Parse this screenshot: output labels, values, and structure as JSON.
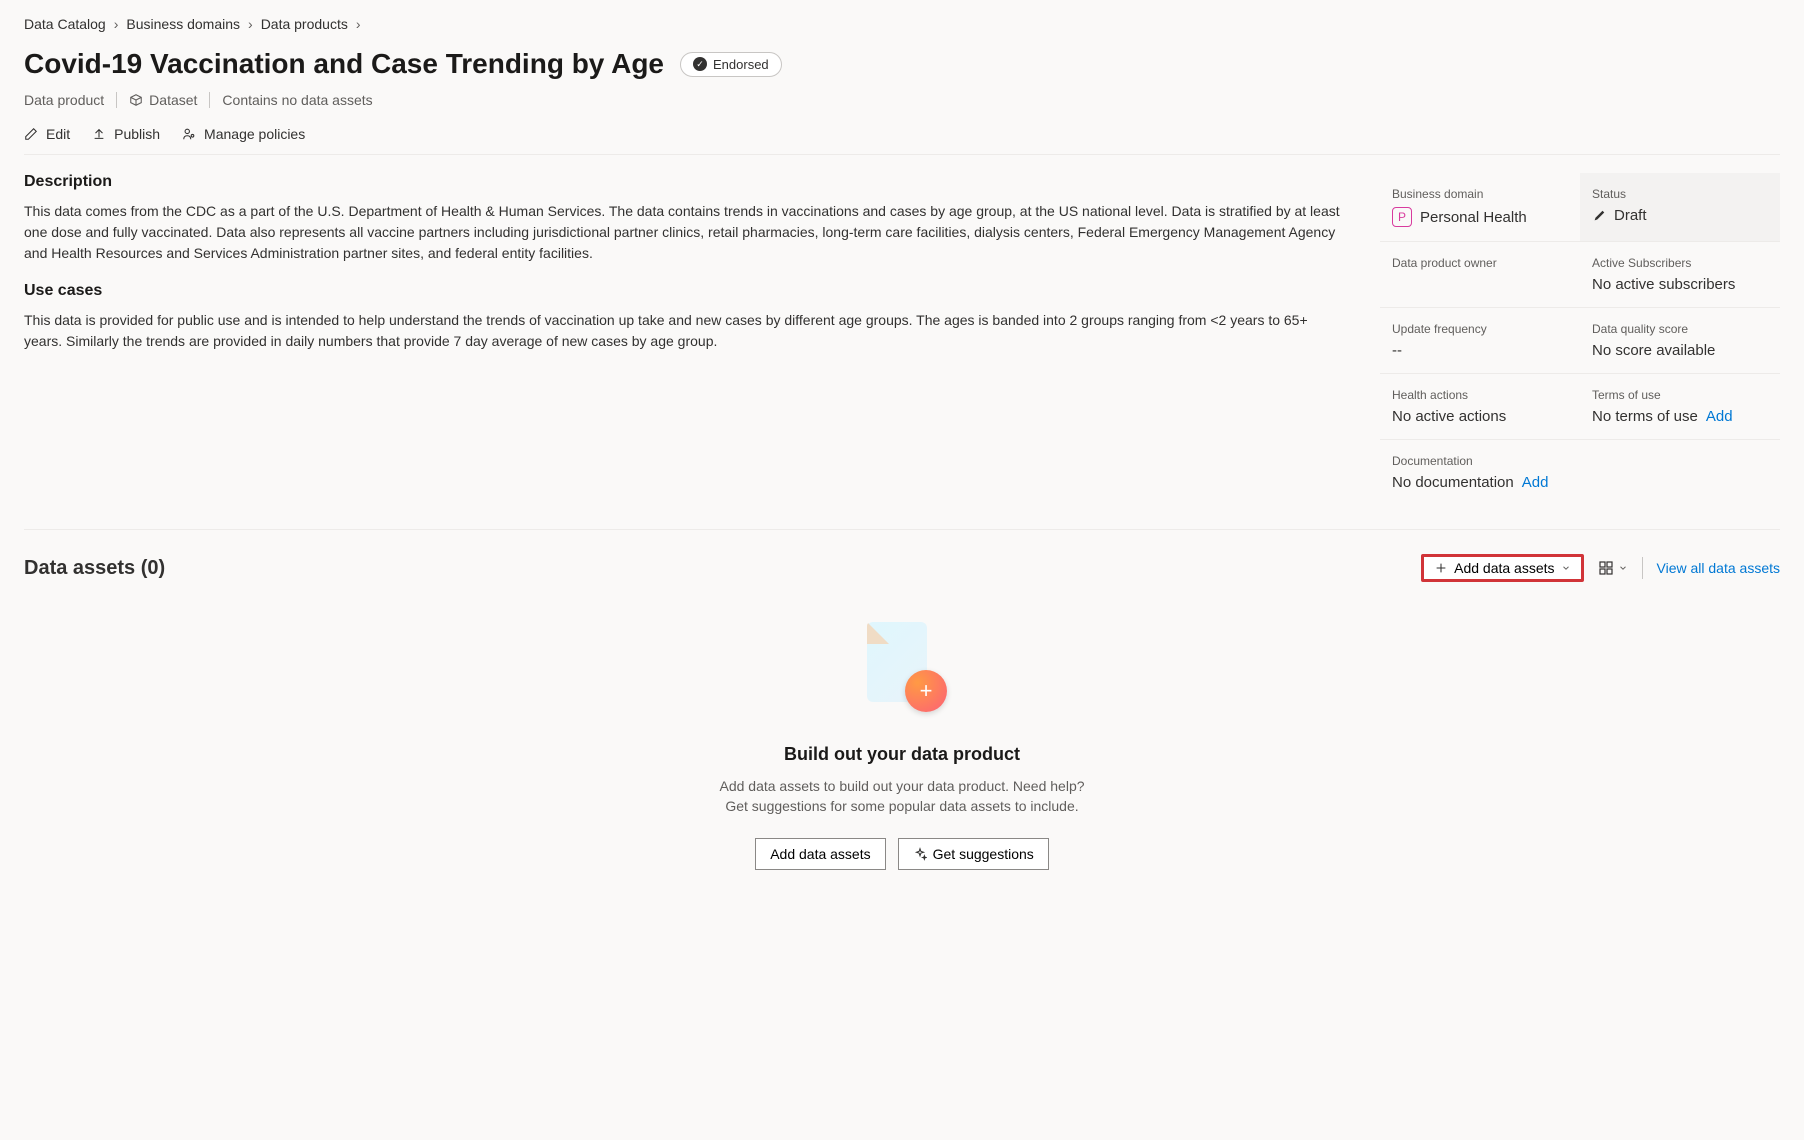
{
  "breadcrumb": {
    "items": [
      "Data Catalog",
      "Business domains",
      "Data products"
    ]
  },
  "title": "Covid-19 Vaccination and Case Trending by Age",
  "badge": {
    "label": "Endorsed"
  },
  "meta": {
    "type": "Data product",
    "dataset_label": "Dataset",
    "assets_note": "Contains no data assets"
  },
  "actions": {
    "edit": "Edit",
    "publish": "Publish",
    "manage_policies": "Manage policies"
  },
  "description": {
    "heading": "Description",
    "text": "This data comes from the CDC as a part of the U.S. Department of Health & Human Services.  The data contains trends in vaccinations and cases by age group, at the US national level. Data is stratified by at least one dose and fully vaccinated. Data also represents all vaccine partners including jurisdictional partner clinics, retail pharmacies, long-term care facilities, dialysis centers, Federal Emergency Management Agency and Health Resources and Services Administration partner sites, and federal entity facilities."
  },
  "usecases": {
    "heading": "Use cases",
    "text": "This data is provided for public use and is intended to help understand the trends of vaccination up take and new cases by different age groups.  The ages is banded into 2 groups ranging from <2 years to 65+ years.  Similarly the trends are provided in daily numbers that provide 7 day average of new cases by age group."
  },
  "sidebar": {
    "business_domain": {
      "label": "Business domain",
      "value": "Personal Health",
      "icon_letter": "P"
    },
    "status": {
      "label": "Status",
      "value": "Draft"
    },
    "owner": {
      "label": "Data product owner",
      "value": ""
    },
    "subscribers": {
      "label": "Active Subscribers",
      "value": "No active subscribers"
    },
    "update_freq": {
      "label": "Update frequency",
      "value": "--"
    },
    "quality": {
      "label": "Data quality score",
      "value": "No score available"
    },
    "health": {
      "label": "Health actions",
      "value": "No active actions"
    },
    "terms": {
      "label": "Terms of use",
      "value": "No terms of use",
      "add_label": "Add"
    },
    "docs": {
      "label": "Documentation",
      "value": "No documentation",
      "add_label": "Add"
    }
  },
  "assets": {
    "title": "Data assets (0)",
    "add_button": "Add data assets",
    "view_all": "View all data assets",
    "empty_title": "Build out your data product",
    "empty_sub": "Add data assets to build out your data product. Need help? Get suggestions for some popular data assets to include.",
    "add_btn": "Add data assets",
    "suggest_btn": "Get suggestions"
  }
}
